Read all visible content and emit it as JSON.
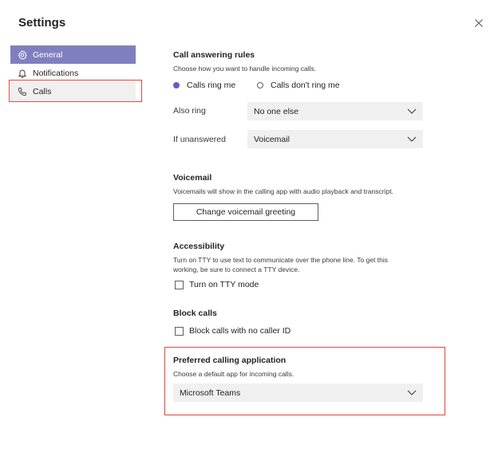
{
  "window": {
    "title": "Settings"
  },
  "sidebar": {
    "items": [
      {
        "label": "General",
        "icon": "gear-icon",
        "state": "selected"
      },
      {
        "label": "Notifications",
        "icon": "bell-icon"
      },
      {
        "label": "Calls",
        "icon": "phone-icon",
        "state": "highlighted"
      }
    ]
  },
  "call_answering": {
    "title": "Call answering rules",
    "description": "Choose how you want to handle incoming calls.",
    "option_ring": "Calls ring me",
    "option_no_ring": "Calls don't ring me",
    "selected_option": "Calls ring me",
    "also_ring_label": "Also ring",
    "also_ring_value": "No one else",
    "unanswered_label": "If unanswered",
    "unanswered_value": "Voicemail"
  },
  "voicemail": {
    "title": "Voicemail",
    "description": "Voicemails will show in the calling app with audio playback and transcript.",
    "button_label": "Change voicemail greeting"
  },
  "accessibility": {
    "title": "Accessibility",
    "description_line1": "Turn on TTY to use text to communicate over the phone line. To get this",
    "description_line2": "working, be sure to connect a TTY device.",
    "tty_label": "Turn on TTY mode",
    "tty_checked": false
  },
  "block_calls": {
    "title": "Block calls",
    "no_caller_id_label": "Block calls with no caller ID",
    "no_caller_id_checked": false
  },
  "preferred_app": {
    "title": "Preferred calling application",
    "description": "Choose a default app for incoming calls.",
    "value": "Microsoft Teams"
  },
  "colors": {
    "accent": "#5b5fc7",
    "selected_nav": "#7f7fbf",
    "highlight": "#e0463a",
    "field_bg": "#f0f0f0"
  }
}
